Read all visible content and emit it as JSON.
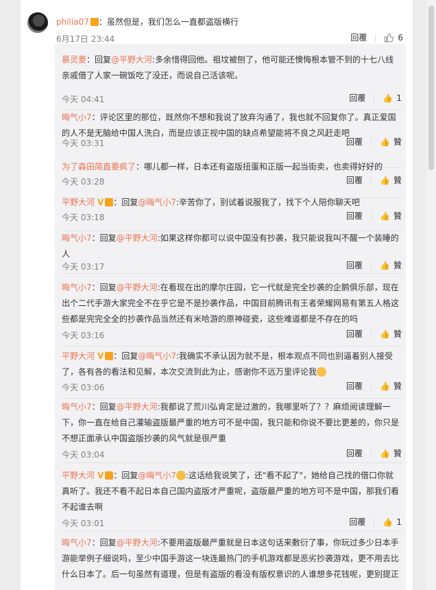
{
  "main": {
    "user": "philia07",
    "text": "：虽然但是，我们怎么一直都盗版横行",
    "time": "6月17日 23:44",
    "reply_label": "回覆",
    "like_count": "6"
  },
  "replies": [
    {
      "user": "慕灵菱",
      "prefix": "：回复",
      "at": "@平野大河",
      "text": ":多余惜得回他。祖坟被刨了，他可能还懊悔根本管不到的十七八线亲戚借了人家一碗饭吃了没还，而说自己活该呢。",
      "time": "今天 04:41",
      "like": "1"
    },
    {
      "user": "晦气小7",
      "prefix": "：",
      "at": "",
      "text": "评论区里的那位，既然你不想和我说了放弃沟通了，我也就不回复你了。真正爱国的人不是无脑给中国人洗白，而是应该正视中国的缺点希望能将不良之风赶走吧",
      "time": "今天 03:31",
      "like": "贊"
    },
    {
      "user": "为了森田简直要疯了",
      "prefix": "：",
      "at": "",
      "text": "哪儿都一样，日本还有盗版扭蛋和正版一起当街卖，也卖得好好的",
      "time": "今天 03:28",
      "like": "贊"
    },
    {
      "user": "平野大河",
      "prefix": "：回复",
      "at": "@晦气小7",
      "text": ":辛苦你了，别试着说服我了，找下个人陪你聊天吧",
      "time": "今天 03:18",
      "like": "贊"
    },
    {
      "user": "晦气小7",
      "prefix": "：回复",
      "at": "@平野大河",
      "text": ":如果这样你都可以说中国没有抄袭，我只能说我叫不醒一个装睡的人",
      "time": "今天 03:17",
      "like": "贊"
    },
    {
      "user": "晦气小7",
      "prefix": "：回复",
      "at": "@平野大河",
      "text": ":在看现在出的摩尔庄园，它一代就是完全抄袭的企鹅俱乐部，现在出个二代手游大家完全不在乎它是不是抄袭作品，中国目前腾讯有王者荣耀网易有第五人格这些都是完完全全的抄袭作品当然还有米哈游的原神碰瓷，这些难道都是不存在的吗",
      "time": "今天 03:16",
      "like": "贊"
    },
    {
      "user": "平野大河",
      "prefix": "：回复",
      "at": "@晦气小7",
      "text": ":我确实不承认因为就不是，根本观点不同也别逼着别人接受了，各有各的看法和见解，本次交流到此为止，感谢你不远万里评论我",
      "time": "今天 03:06",
      "like": "贊"
    },
    {
      "user": "晦气小7",
      "prefix": "：回复",
      "at": "@平野大河",
      "text": ":我都说了荒川弘肯定是过激的，我哪里听了？？麻烦阅读理解一下，你一直在给自己灌输盗版最严重的地方可不是中国，我只能和你说不要比更差的，你只是不想正面承认中国盗版抄袭的风气就是很严重",
      "time": "今天 03:04",
      "like": "贊"
    },
    {
      "user": "平野大河",
      "prefix": "：回复",
      "at": "@晦气小7",
      "text": ":这话给我说笑了，还\"看不起了\"，她给自己找的借口你就真听了。我还不看不起日本自己国内盗版才严重呢，盗版最严重的地方可不是中国，那我们看不起谁去啊",
      "time": "今天 03:01",
      "like": "1"
    },
    {
      "user": "晦气小7",
      "prefix": "：回复",
      "at": "@平野大河",
      "text": ":不要用盗版最严重就是日本这句话来敷衍了事，你玩过多少日本手游能举例子细说吗，至少中国手游这一块连最热门的手机游戏都是恶劣抄袭游戏，更不用去比什么日本了。后一句虽然有道理，但是有盗版的看没有版权意识的人谁想多花钱呢，更别提正",
      "time": "",
      "like": ""
    }
  ],
  "reply_label": "回覆",
  "colors": {
    "link": "#eb7350",
    "muted": "#808080",
    "panel": "#f2f2f5"
  }
}
